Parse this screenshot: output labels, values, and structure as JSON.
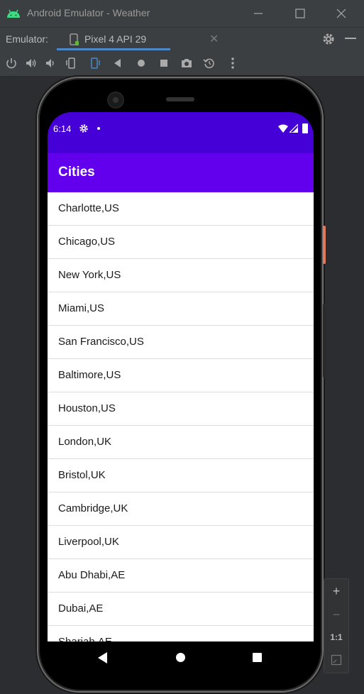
{
  "window": {
    "title": "Android Emulator - Weather",
    "icon": "android-icon",
    "controls": [
      "minimize-icon",
      "maximize-icon",
      "close-icon"
    ]
  },
  "tabbar": {
    "label": "Emulator:",
    "device_tab": "Pixel 4 API 29",
    "close_glyph": "✕",
    "accent": "#4a88c7"
  },
  "toolbar": {
    "tools": [
      "power-icon",
      "volume-up-icon",
      "volume-down-icon",
      "rotate-left-icon",
      "rotate-right-icon",
      "back-icon",
      "home-icon",
      "overview-icon",
      "screenshot-icon",
      "snapshot-icon",
      "more-icon"
    ]
  },
  "device": {
    "status_bar": {
      "time": "6:14",
      "color": "#4400d6"
    },
    "app_bar": {
      "title": "Cities",
      "color": "#6200ee"
    },
    "cities": [
      "Charlotte,US",
      "Chicago,US",
      "New York,US",
      "Miami,US",
      "San Francisco,US",
      "Baltimore,US",
      "Houston,US",
      "London,UK",
      "Bristol,UK",
      "Cambridge,UK",
      "Liverpool,UK",
      "Abu Dhabi,AE",
      "Dubai,AE",
      "Sharjah,AE"
    ]
  },
  "zoom": {
    "zoom_in": "+",
    "zoom_out": "−",
    "actual_size": "1:1"
  }
}
